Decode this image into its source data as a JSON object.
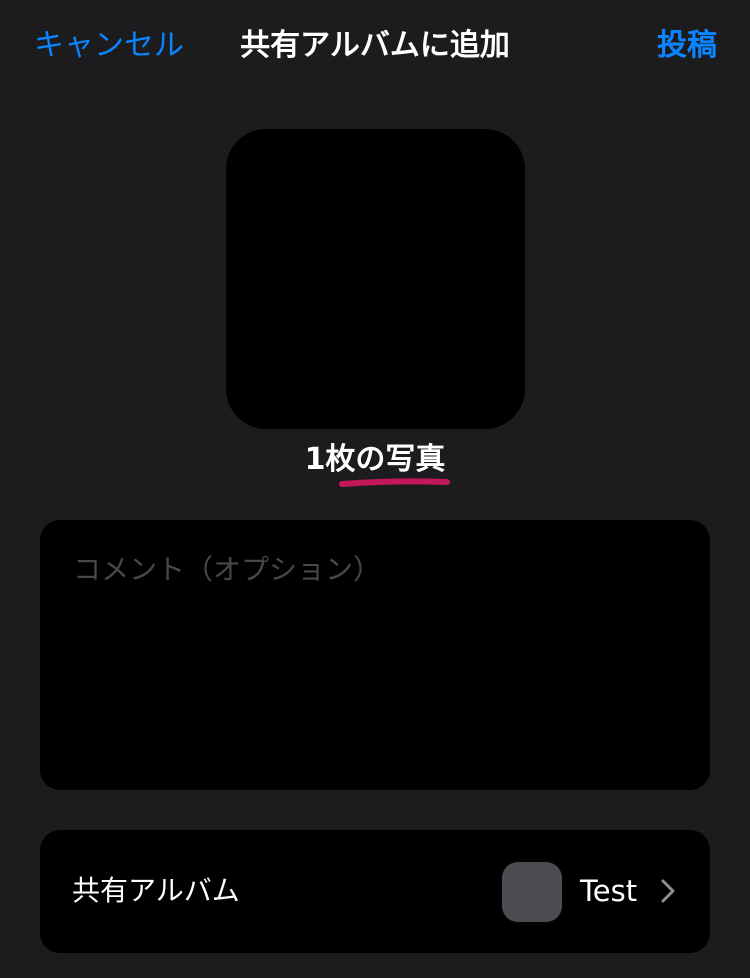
{
  "nav": {
    "cancel_label": "キャンセル",
    "title": "共有アルバムに追加",
    "post_label": "投稿"
  },
  "photo": {
    "count_label": "1枚の写真"
  },
  "comment": {
    "placeholder": "コメント（オプション）",
    "value": ""
  },
  "album": {
    "row_label": "共有アルバム",
    "selected_name": "Test",
    "chevron_icon": "chevron-right-icon"
  },
  "colors": {
    "accent": "#0a84ff",
    "background": "#1c1c1e",
    "card": "#000000",
    "annotation": "#c2185b"
  }
}
